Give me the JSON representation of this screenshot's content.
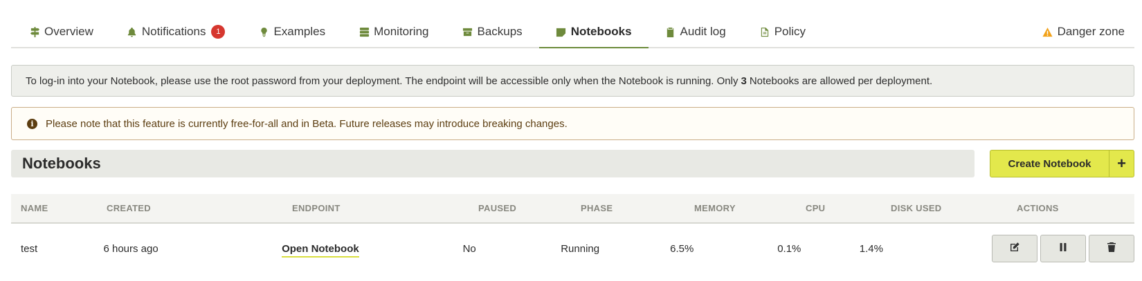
{
  "tabs": [
    {
      "label": "Overview",
      "icon": "signpost-icon"
    },
    {
      "label": "Notifications",
      "icon": "bell-icon",
      "badge": "1"
    },
    {
      "label": "Examples",
      "icon": "lightbulb-icon"
    },
    {
      "label": "Monitoring",
      "icon": "server-icon"
    },
    {
      "label": "Backups",
      "icon": "archive-icon"
    },
    {
      "label": "Notebooks",
      "icon": "sticky-note-icon",
      "active": true
    },
    {
      "label": "Audit log",
      "icon": "clipboard-icon"
    },
    {
      "label": "Policy",
      "icon": "document-icon"
    },
    {
      "label": "Danger zone",
      "icon": "warning-icon"
    }
  ],
  "info_banner": {
    "text_before": "To log-in into your Notebook, please use the root password from your deployment. The endpoint will be accessible only when the Notebook is running. Only",
    "limit": "3",
    "text_after": "Notebooks are allowed per deployment."
  },
  "warning_banner": {
    "icon": "info-circle-icon",
    "text": "Please note that this feature is currently free-for-all and in Beta. Future releases may introduce breaking changes."
  },
  "section": {
    "title": "Notebooks",
    "create_button": "Create Notebook",
    "create_plus": "+"
  },
  "table": {
    "headers": {
      "name": "NAME",
      "created": "CREATED",
      "endpoint": "ENDPOINT",
      "paused": "PAUSED",
      "phase": "PHASE",
      "memory": "MEMORY",
      "cpu": "CPU",
      "disk": "DISK USED",
      "actions": "ACTIONS"
    },
    "rows": [
      {
        "name": "test",
        "created": "6 hours ago",
        "endpoint": "Open Notebook",
        "paused": "No",
        "phase": "Running",
        "memory": "6.5%",
        "cpu": "0.1%",
        "disk": "1.4%",
        "actions": [
          "edit-icon",
          "pause-icon",
          "trash-icon"
        ]
      }
    ]
  },
  "colors": {
    "accent_green": "#6b8a3a",
    "create_yellow": "#e3e84c",
    "badge_red": "#d6372f",
    "warning_orange": "#f2a21a"
  }
}
